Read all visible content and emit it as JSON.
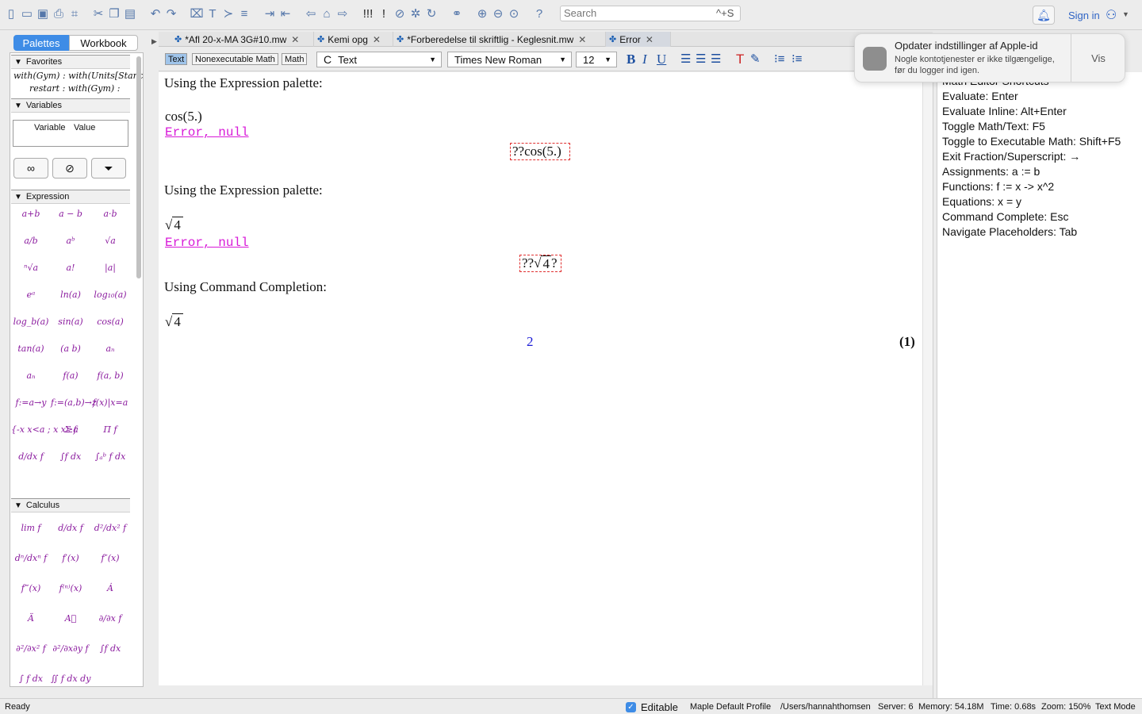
{
  "toolbar": {
    "search_placeholder": "Search",
    "search_shortcut": "^+S",
    "sign_in": "Sign in"
  },
  "left_panel": {
    "tabs": [
      "Palettes",
      "Workbook"
    ],
    "favorites": {
      "title": "Favorites",
      "line1": "with(Gym) : with(Units[Stanc",
      "line2": "restart : with(Gym) :"
    },
    "variables": {
      "title": "Variables",
      "col_variable": "Variable",
      "col_value": "Value"
    },
    "expression": {
      "title": "Expression",
      "items": [
        "a+b",
        "a − b",
        "a·b",
        "a/b",
        "aᵇ",
        "√a",
        "ⁿ√a",
        "a!",
        "|a|",
        "eᵃ",
        "ln(a)",
        "log₁₀(a)",
        "log_b(a)",
        "sin(a)",
        "cos(a)",
        "tan(a)",
        "(a b)",
        "aₙ",
        "aₙ",
        "f(a)",
        "f(a, b)",
        "f:=a→y",
        "f:=(a,b)→z",
        "f(x)|x=a",
        "{-x x<a ; x x≥a",
        "Σ f",
        "Π f",
        "d/dx f",
        "∫f dx",
        "∫ₐᵇ f dx"
      ]
    },
    "calculus": {
      "title": "Calculus",
      "items": [
        "lim f",
        "d/dx f",
        "d²/dx² f",
        "dⁿ/dxⁿ f",
        "f′(x)",
        "f″(x)",
        "f‴(x)",
        "f⁽ⁿ⁾(x)",
        "Ȧ",
        "Ä",
        "A⃛",
        "∂/∂x f",
        "∂²/∂x² f",
        "∂²/∂x∂y f",
        "∫f dx",
        "∫ f dx",
        "∬ f dx dy"
      ]
    }
  },
  "tabs": [
    {
      "label": "*Afl 20-x-MA 3G#10.mw"
    },
    {
      "label": "Kemi opg"
    },
    {
      "label": "*Forberedelse til skriftlig - Keglesnit.mw"
    },
    {
      "label": "Error"
    }
  ],
  "format_bar": {
    "mode_text": "Text",
    "mode_nonexec": "Nonexecutable Math",
    "mode_math": "Math",
    "style": "Text",
    "font": "Times New Roman",
    "size": "12"
  },
  "document": {
    "heading1": "Using the Expression palette:",
    "input1": "cos(5.)",
    "error1": "Error, null",
    "box1": "??cos(5.)",
    "heading2": "Using the Expression palette:",
    "input2_radicand": "4",
    "error2": "Error, null",
    "box2_prefix": "??",
    "box2_radicand": "4",
    "box2_suffix": "?",
    "heading3": "Using Command Completion:",
    "input3_radicand": "4",
    "output_value": "2",
    "output_label": "(1)"
  },
  "shortcuts": [
    "Math Editor Shortcuts",
    "Evaluate:  Enter",
    "Evaluate Inline:  Alt+Enter",
    "Toggle Math/Text:  F5",
    "Toggle to Executable Math:  Shift+F5",
    "Exit Fraction/Superscript:  →",
    "Assignments:  a := b",
    "Functions:  f := x -> x^2",
    "Equations:  x = y",
    "Command Complete:  Esc",
    "Navigate Placeholders:  Tab"
  ],
  "notification": {
    "title": "Opdater indstillinger af Apple-id",
    "body": "Nogle kontotjenester er ikke tilgængelige, før du logger ind igen.",
    "action": "Vis"
  },
  "status_bar": {
    "ready": "Ready",
    "editable": "Editable",
    "profile": "Maple Default Profile",
    "path": "/Users/hannahthomsen",
    "server": "Server: 6",
    "memory": "Memory: 54.18M",
    "time": "Time: 0.68s",
    "zoom": "Zoom: 150%",
    "mode": "Text Mode"
  },
  "colors": {
    "accent": "#3e8ce6",
    "error_text": "#d81ad8",
    "output_blue": "#1a1ad6",
    "palette_magenta": "#8a1a9e",
    "palette_green": "#1a8a3a"
  }
}
